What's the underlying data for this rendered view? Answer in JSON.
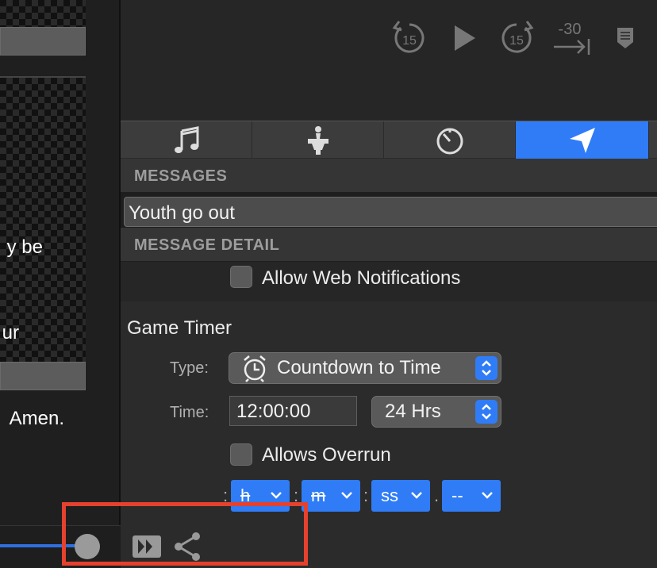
{
  "preview": {
    "lyrics": [
      "y be",
      "ur",
      "Amen."
    ]
  },
  "transport": {
    "rewind_label": "15",
    "forward_label": "15",
    "jump_label": "-30"
  },
  "tabs": [
    {
      "name": "audio",
      "icon": "music-note-icon"
    },
    {
      "name": "props",
      "icon": "podium-icon"
    },
    {
      "name": "timers",
      "icon": "timer-icon"
    },
    {
      "name": "messages",
      "icon": "send-icon",
      "active": true
    }
  ],
  "messages": {
    "header": "MESSAGES",
    "items": [
      "Youth go out"
    ]
  },
  "message_detail": {
    "header": "MESSAGE DETAIL",
    "allow_web_notifications": "Allow Web Notifications",
    "token_name": "Game Timer",
    "type_label": "Type:",
    "type_value": "Countdown to Time",
    "time_label": "Time:",
    "time_value": "12:00:00",
    "clock_format": "24 Hrs",
    "allows_overrun": "Allows Overrun",
    "format": {
      "hours": "h",
      "minutes": "m",
      "seconds": "ss",
      "sub": "--"
    },
    "separators": [
      ":",
      ":",
      ":",
      "."
    ]
  },
  "colors": {
    "accent": "#2f7cf6",
    "highlight": "#e4412e"
  },
  "playback": {
    "progress": 0.8
  }
}
